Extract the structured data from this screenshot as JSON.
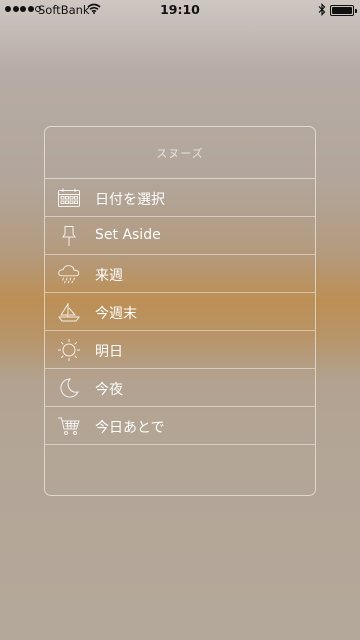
{
  "status_bar": {
    "carrier": "SoftBank",
    "time": "19:10",
    "icons": [
      "signal-icon",
      "wifi-icon",
      "bluetooth-icon",
      "battery-icon"
    ]
  },
  "panel": {
    "title": "スヌーズ",
    "items": [
      {
        "label": "日付を選択",
        "icon": "calendar-icon"
      },
      {
        "label": "Set Aside",
        "icon": "pin-icon"
      },
      {
        "label": "来週",
        "icon": "rain-cloud-icon"
      },
      {
        "label": "今週末",
        "icon": "sailboat-icon"
      },
      {
        "label": "明日",
        "icon": "sun-icon"
      },
      {
        "label": "今夜",
        "icon": "moon-icon"
      },
      {
        "label": "今日あとで",
        "icon": "cart-icon"
      }
    ]
  },
  "colors": {
    "accent_band": "#bc8f55",
    "panel_border": "#ffffff"
  }
}
